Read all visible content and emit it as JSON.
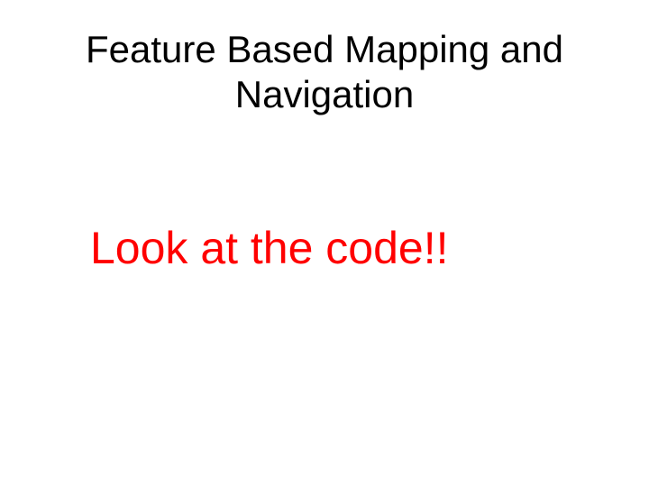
{
  "slide": {
    "title": "Feature Based Mapping and Navigation",
    "body": "Look at the code!!"
  }
}
